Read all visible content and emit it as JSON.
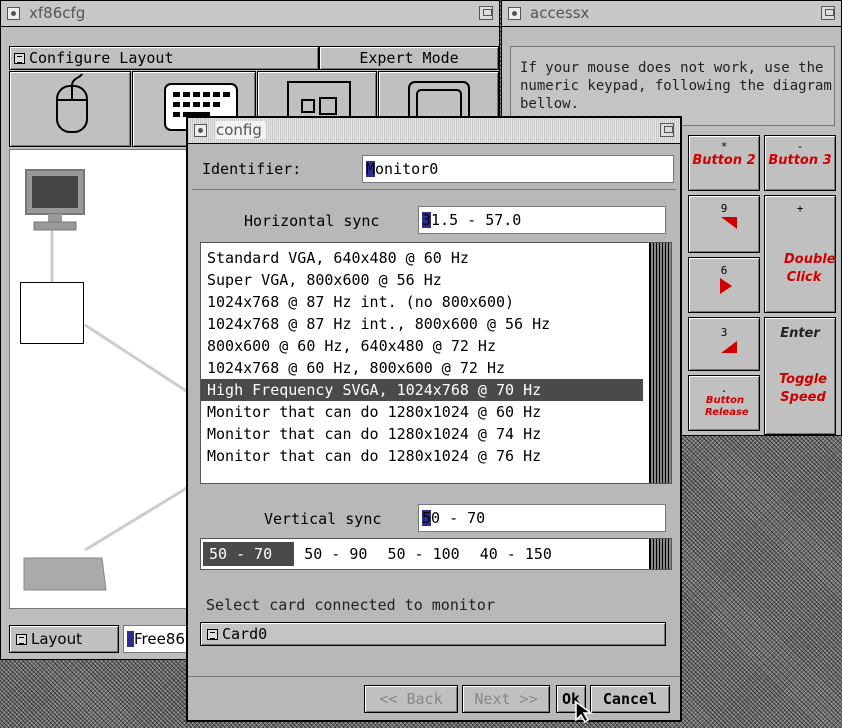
{
  "xf86cfg": {
    "title": "xf86cfg",
    "menu_configure": "Configure Layout",
    "menu_expert": "Expert Mode",
    "layout_label": "Layout",
    "layout_field": "Free86"
  },
  "accessx": {
    "title": "accessx",
    "help_text": "If your mouse does not work, use the numeric keypad, following the diagram bellow.",
    "keys": {
      "button2": "Button 2",
      "button3": "Button 3",
      "k9": "9",
      "plus": "+",
      "k6": "6",
      "double_click": "Double Click",
      "k3": "3",
      "enter": "Enter",
      "dot": ".",
      "button_release": "Button Release",
      "toggle_speed": "Toggle Speed"
    }
  },
  "config": {
    "title": "config",
    "identifier_label": "Identifier:",
    "identifier_value": "Monitor0",
    "hsync_label": "Horizontal sync",
    "hsync_value": "31.5 - 57.0",
    "monitor_options": [
      "Standard VGA, 640x480 @ 60 Hz",
      "Super VGA, 800x600 @ 56 Hz",
      "1024x768 @ 87 Hz int. (no 800x600)",
      "1024x768 @ 87 Hz int., 800x600 @ 56 Hz",
      "800x600 @ 60 Hz, 640x480 @ 72 Hz",
      "1024x768 @ 60 Hz, 800x600 @ 72 Hz",
      "High Frequency SVGA, 1024x768 @ 70 Hz",
      "Monitor that can do 1280x1024 @ 60 Hz",
      "Monitor that can do 1280x1024 @ 74 Hz",
      "Monitor that can do 1280x1024 @ 76 Hz"
    ],
    "selected_monitor_option": "High Frequency SVGA, 1024x768 @ 70 Hz",
    "vsync_label": "Vertical sync",
    "vsync_value": "50 - 70",
    "vsync_options": [
      "50 - 70",
      "50 - 90",
      "50 - 100",
      "40 - 150"
    ],
    "selected_vsync_option": "50 - 70",
    "card_label": "Select card connected to monitor",
    "card_value": "Card0",
    "back_label": "<< Back",
    "next_label": "Next >>",
    "ok_label": "Ok",
    "cancel_label": "Cancel"
  },
  "colors": {
    "keypad_red": "#d00000",
    "selection_bg": "#4a4a4a",
    "window_bg": "#bdbdbd"
  }
}
